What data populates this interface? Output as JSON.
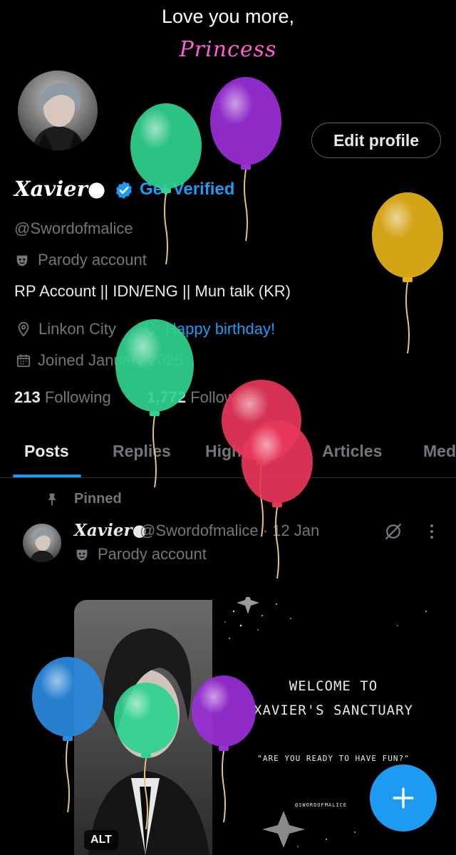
{
  "banner": {
    "line1": "Love you more,",
    "line2": "Princess"
  },
  "profile": {
    "name": "Xavier",
    "name_suffix": "●",
    "get_verified": "Get Verified",
    "handle": "@Swordofmalice",
    "parody_label": "Parody account",
    "bio": "RP Account || IDN/ENG || Mun talk (KR)",
    "location": "Linkon City",
    "birthday": "Happy birthday!",
    "joined": "Joined January 2025",
    "following_count": "213",
    "following_label": "Following",
    "followers_count": "1,772",
    "followers_label": "Followers",
    "edit_profile": "Edit profile"
  },
  "tabs": [
    {
      "label": "Posts"
    },
    {
      "label": "Replies"
    },
    {
      "label": "Highlights"
    },
    {
      "label": "Articles"
    },
    {
      "label": "Media"
    }
  ],
  "post": {
    "pinned_label": "Pinned",
    "author": "Xavier●",
    "meta": "@Swordofmalice · 12 Jan",
    "parody_label": "Parody account",
    "media": {
      "welcome_line1": "WELCOME TO",
      "welcome_line2": "XAVIER'S SANCTUARY",
      "quote": "\"ARE YOU READY TO HAVE FUN?\"",
      "handle": "@SWORDOFMALICE",
      "alt_badge": "ALT"
    }
  },
  "colors": {
    "accent": "#1d9bf0",
    "background": "#000000",
    "muted_text": "#71767b",
    "princess_pink": "#ff5fd2"
  },
  "icons": {
    "verified": "verified-badge-icon",
    "parody": "theater-mask-icon",
    "location": "location-pin-icon",
    "birthday": "balloon-icon",
    "joined": "calendar-icon",
    "pinned": "pin-icon",
    "grok": "grok-icon",
    "more": "more-vertical-icon",
    "compose": "plus-icon"
  },
  "decorations": {
    "balloon_colors": [
      "#2fd38f",
      "#9b30d9",
      "#e6b219",
      "#2fd38f",
      "#e8365a",
      "#e8365a",
      "#2a8be0",
      "#2fd38f",
      "#9b30d9"
    ]
  }
}
